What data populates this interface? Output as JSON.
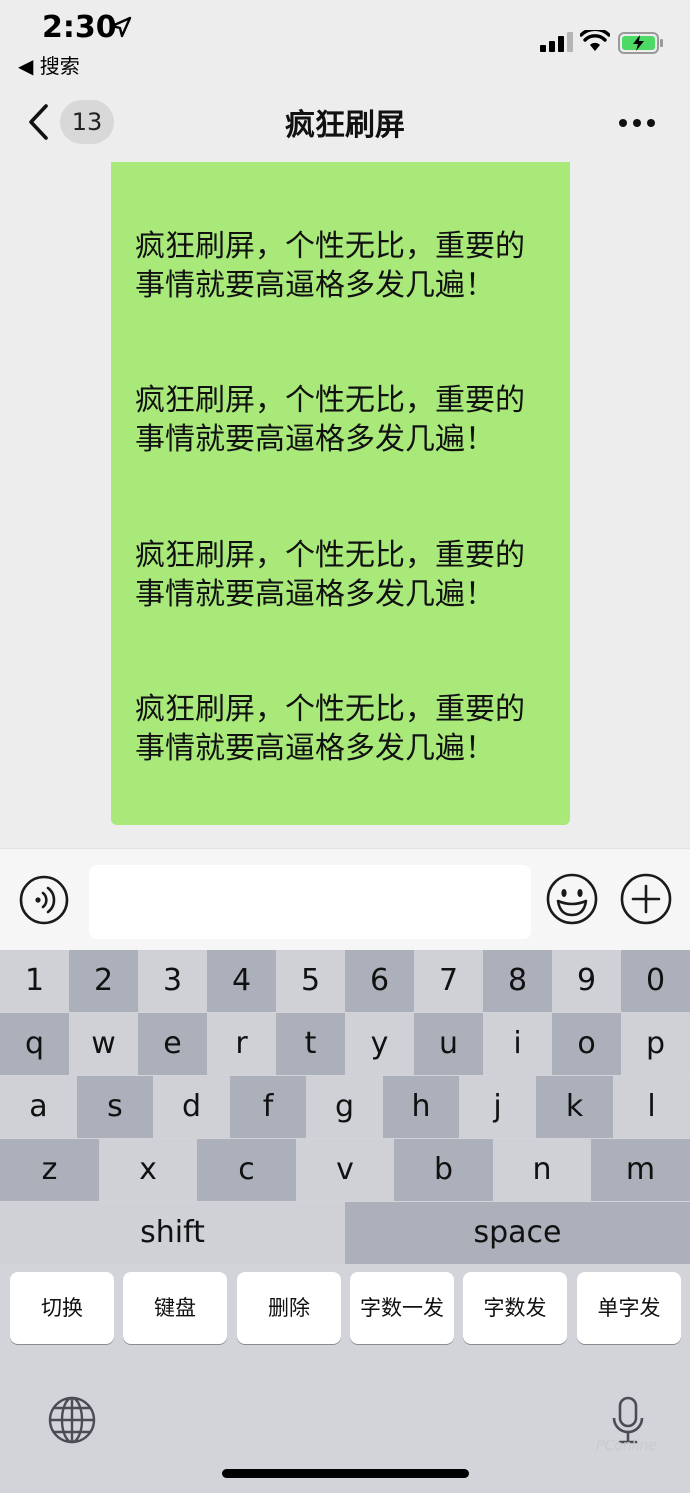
{
  "status_bar": {
    "time": "2:30",
    "back_app": "◀ 搜索"
  },
  "nav": {
    "unread_count": "13",
    "title": "疯狂刷屏"
  },
  "chat": {
    "message_lines": [
      "疯狂刷屏，个性无比，重要的",
      "事情就要高逼格多发几遍！",
      "疯狂刷屏，个性无比，重要的",
      "事情就要高逼格多发几遍！",
      "疯狂刷屏，个性无比，重要的",
      "事情就要高逼格多发几遍！",
      "疯狂刷屏，个性无比，重要的",
      "事情就要高逼格多发几遍！"
    ]
  },
  "keyboard": {
    "row1": [
      "1",
      "2",
      "3",
      "4",
      "5",
      "6",
      "7",
      "8",
      "9",
      "0"
    ],
    "row2": [
      "q",
      "w",
      "e",
      "r",
      "t",
      "y",
      "u",
      "i",
      "o",
      "p"
    ],
    "row3": [
      "a",
      "s",
      "d",
      "f",
      "g",
      "h",
      "j",
      "k",
      "l"
    ],
    "row4": [
      "z",
      "x",
      "c",
      "v",
      "b",
      "n",
      "m"
    ],
    "shift": "shift",
    "space": "space",
    "actions": [
      "切换",
      "键盘",
      "删除",
      "字数一发",
      "字数发",
      "单字发"
    ]
  },
  "watermark": "PConline",
  "colors": {
    "bubble": "#a9e97a",
    "background": "#ededed",
    "keyboard": "#d2d4d9"
  }
}
